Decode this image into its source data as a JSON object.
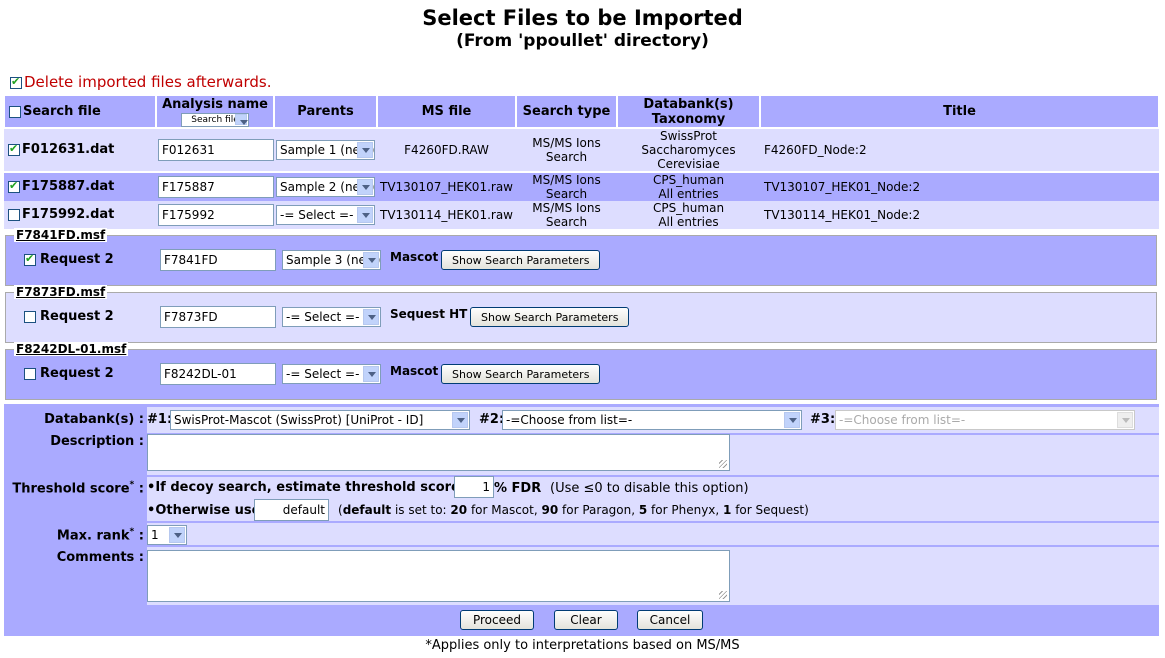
{
  "page": {
    "title": "Select Files to be Imported",
    "subtitle": "(From 'ppoullet' directory)",
    "delete_label": "Delete imported files afterwards."
  },
  "table": {
    "headers": {
      "search_file": "Search file",
      "analysis_name": "Analysis name",
      "analysis_selector": "Search file",
      "parents": "Parents",
      "ms_file": "MS file",
      "search_type": "Search type",
      "databank_line1": "Databank(s)",
      "databank_line2": "Taxonomy",
      "title": "Title"
    },
    "rows": [
      {
        "checked": true,
        "file": "F012631.dat",
        "analysis": "F012631",
        "parent": "Sample 1 (new)",
        "ms_file": "F4260FD.RAW",
        "search_type_1": "MS/MS Ions",
        "search_type_2": "Search",
        "databank_1": "SwissProt",
        "databank_2": "Saccharomyces",
        "databank_3": "Cerevisiae",
        "title": "F4260FD_Node:2"
      },
      {
        "checked": true,
        "file": "F175887.dat",
        "analysis": "F175887",
        "parent": "Sample 2 (new)",
        "ms_file": "TV130107_HEK01.raw",
        "search_type_1": "MS/MS Ions",
        "search_type_2": "Search",
        "databank_1": "CPS_human",
        "databank_2": "All entries",
        "databank_3": "",
        "title": "TV130107_HEK01_Node:2"
      },
      {
        "checked": false,
        "file": "F175992.dat",
        "analysis": "F175992",
        "parent": "-= Select =-",
        "ms_file": "TV130114_HEK01.raw",
        "search_type_1": "MS/MS Ions",
        "search_type_2": "Search",
        "databank_1": "CPS_human",
        "databank_2": "All entries",
        "databank_3": "",
        "title": "TV130114_HEK01_Node:2"
      }
    ]
  },
  "msf_groups": [
    {
      "name": "F7841FD.msf",
      "checked": true,
      "request": "Request 2",
      "analysis": "F7841FD",
      "parent": "Sample 3 (new)",
      "engine": "Mascot",
      "button": "Show Search Parameters"
    },
    {
      "name": "F7873FD.msf",
      "checked": false,
      "request": "Request 2",
      "analysis": "F7873FD",
      "parent": "-= Select =-",
      "engine": "Sequest HT",
      "button": "Show Search Parameters"
    },
    {
      "name": "F8242DL-01.msf",
      "checked": false,
      "request": "Request 2",
      "analysis": "F8242DL-01",
      "parent": "-= Select =-",
      "engine": "Mascot",
      "button": "Show Search Parameters"
    }
  ],
  "form": {
    "databank_label": "Databank(s) :",
    "db1_label": "#1:",
    "db1_value": "SwisProt-Mascot (SwissProt) [UniProt - ID]",
    "db2_label": "#2:",
    "db2_value": "-=Choose from list=-",
    "db3_label": "#3:",
    "db3_value": "-=Choose from list=-",
    "description_label": "Description :",
    "threshold_label": "Threshold score",
    "threshold_star": "*",
    "threshold_colon": " :",
    "decoy_text": "If decoy search, estimate threshold score for",
    "fdr_value": "1",
    "fdr_suffix": "% FDR",
    "fdr_note": "(Use ≤0 to disable this option)",
    "otherwise_text": "Otherwise use",
    "otherwise_value": "default",
    "default_note_b1": "default",
    "default_note_1": " is set to: ",
    "default_note_b2": "20",
    "default_note_2": " for Mascot, ",
    "default_note_b3": "90",
    "default_note_3": " for Paragon, ",
    "default_note_b4": "5",
    "default_note_4": " for Phenyx, ",
    "default_note_b5": "1",
    "default_note_5": " for Sequest)",
    "default_note_open": "(",
    "maxrank_label": "Max. rank",
    "maxrank_star": "*",
    "maxrank_colon": " :",
    "maxrank_value": "1",
    "comments_label": "Comments :",
    "proceed": "Proceed",
    "clear": "Clear",
    "cancel": "Cancel"
  },
  "footnote": "*Applies only to interpretations based on MS/MS"
}
